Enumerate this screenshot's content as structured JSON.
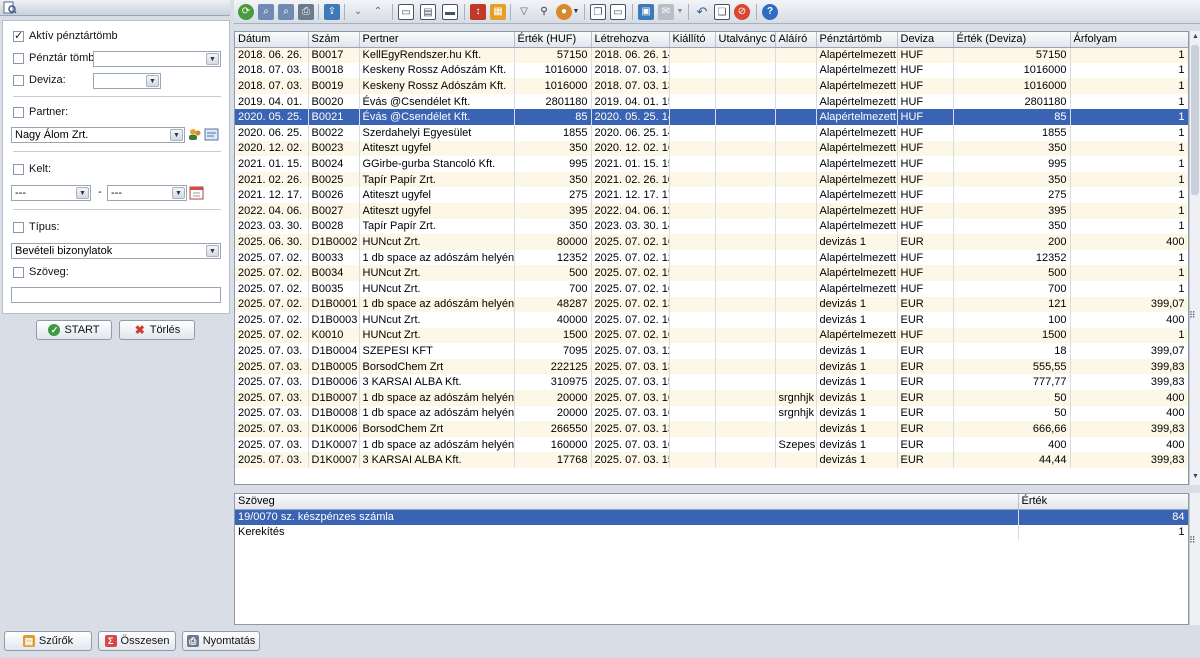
{
  "filters": {
    "active_cashbook": {
      "label": "Aktív pénztártömb",
      "checked": true
    },
    "cashbook": {
      "label": "Pénztár tömb:",
      "checked": false,
      "value": ""
    },
    "currency": {
      "label": "Deviza:",
      "checked": false,
      "value": ""
    },
    "partner": {
      "label": "Partner:",
      "checked": false,
      "value": "Nagy Álom Zrt."
    },
    "date": {
      "label": "Kelt:",
      "checked": false,
      "from": "---",
      "dash": "-",
      "to": "---"
    },
    "type": {
      "label": "Típus:",
      "checked": false,
      "value": "Bevételi bizonylatok"
    },
    "text": {
      "label": "Szöveg:",
      "checked": false,
      "value": ""
    }
  },
  "actions": {
    "start": "START",
    "clear": "Törlés"
  },
  "bottom": {
    "filters": "Szűrők",
    "summary": "Összesen",
    "print": "Nyomtatás"
  },
  "grid": {
    "columns": [
      "Dátum",
      "Szám",
      "Pertner",
      "Érték (HUF)",
      "Létrehozva",
      "Kiállító",
      "Utalványc 0",
      "Aláíró",
      "Pénztártömb",
      "Deviza",
      "Érték (Deviza)",
      "Árfolyam"
    ],
    "selected_index": 4,
    "rows": [
      [
        "2018. 06. 26.",
        "B0017",
        "KellEgyRendszer.hu Kft.",
        "57150",
        "2018. 06. 26. 14:",
        "",
        "",
        "",
        "Alapértelmezett",
        "HUF",
        "57150",
        "1"
      ],
      [
        "2018. 07. 03.",
        "B0018",
        "Keskeny Rossz Adószám Kft.",
        "1016000",
        "2018. 07. 03. 13:",
        "",
        "",
        "",
        "Alapértelmezett",
        "HUF",
        "1016000",
        "1"
      ],
      [
        "2018. 07. 03.",
        "B0019",
        "Keskeny Rossz Adószám Kft.",
        "1016000",
        "2018. 07. 03. 13:",
        "",
        "",
        "",
        "Alapértelmezett",
        "HUF",
        "1016000",
        "1"
      ],
      [
        "2019. 04. 01.",
        "B0020",
        "Évás @Csendélet Kft.",
        "2801180",
        "2019. 04. 01. 15:",
        "",
        "",
        "",
        "Alapértelmezett",
        "HUF",
        "2801180",
        "1"
      ],
      [
        "2020. 05. 25.",
        "B0021",
        "Évás @Csendélet Kft.",
        "85",
        "2020. 05. 25. 14:",
        "",
        "",
        "",
        "Alapértelmezett",
        "HUF",
        "85",
        "1"
      ],
      [
        "2020. 06. 25.",
        "B0022",
        "Szerdahelyi Egyesület",
        "1855",
        "2020. 06. 25. 14:",
        "",
        "",
        "",
        "Alapértelmezett",
        "HUF",
        "1855",
        "1"
      ],
      [
        "2020. 12. 02.",
        "B0023",
        "Atiteszt ugyfel",
        "350",
        "2020. 12. 02. 16:",
        "",
        "",
        "",
        "Alapértelmezett",
        "HUF",
        "350",
        "1"
      ],
      [
        "2021. 01. 15.",
        "B0024",
        "GGirbe-gurba Stancoló Kft.",
        "995",
        "2021. 01. 15. 15:",
        "",
        "",
        "",
        "Alapértelmezett",
        "HUF",
        "995",
        "1"
      ],
      [
        "2021. 02. 26.",
        "B0025",
        "Tapír Papír Zrt.",
        "350",
        "2021. 02. 26. 10:",
        "",
        "",
        "",
        "Alapértelmezett",
        "HUF",
        "350",
        "1"
      ],
      [
        "2021. 12. 17.",
        "B0026",
        "Atiteszt ugyfel",
        "275",
        "2021. 12. 17. 17:",
        "",
        "",
        "",
        "Alapértelmezett",
        "HUF",
        "275",
        "1"
      ],
      [
        "2022. 04. 06.",
        "B0027",
        "Atiteszt ugyfel",
        "395",
        "2022. 04. 06. 11:",
        "",
        "",
        "",
        "Alapértelmezett",
        "HUF",
        "395",
        "1"
      ],
      [
        "2023. 03. 30.",
        "B0028",
        "Tapír Papír Zrt.",
        "350",
        "2023. 03. 30. 14:",
        "",
        "",
        "",
        "Alapértelmezett",
        "HUF",
        "350",
        "1"
      ],
      [
        "2025. 06. 30.",
        "D1B0002",
        "HUNcut Zrt.",
        "80000",
        "2025. 07. 02. 16:",
        "",
        "",
        "",
        "devizás 1",
        "EUR",
        "200",
        "400"
      ],
      [
        "2025. 07. 02.",
        "B0033",
        "1 db space az adószám helyén",
        "12352",
        "2025. 07. 02. 12:",
        "",
        "",
        "",
        "Alapértelmezett",
        "HUF",
        "12352",
        "1"
      ],
      [
        "2025. 07. 02.",
        "B0034",
        "HUNcut Zrt.",
        "500",
        "2025. 07. 02. 15:",
        "",
        "",
        "",
        "Alapértelmezett",
        "HUF",
        "500",
        "1"
      ],
      [
        "2025. 07. 02.",
        "B0035",
        "HUNcut Zrt.",
        "700",
        "2025. 07. 02. 16:",
        "",
        "",
        "",
        "Alapértelmezett",
        "HUF",
        "700",
        "1"
      ],
      [
        "2025. 07. 02.",
        "D1B0001",
        "1 db space az adószám helyén",
        "48287",
        "2025. 07. 02. 13:",
        "",
        "",
        "",
        "devizás 1",
        "EUR",
        "121",
        "399,07"
      ],
      [
        "2025. 07. 02.",
        "D1B0003",
        "HUNcut Zrt.",
        "40000",
        "2025. 07. 02. 16:",
        "",
        "",
        "",
        "devizás 1",
        "EUR",
        "100",
        "400"
      ],
      [
        "2025. 07. 02.",
        "K0010",
        "HUNcut Zrt.",
        "1500",
        "2025. 07. 02. 16:",
        "",
        "",
        "",
        "Alapértelmezett",
        "HUF",
        "1500",
        "1"
      ],
      [
        "2025. 07. 03.",
        "D1B0004",
        "SZEPESI KFT",
        "7095",
        "2025. 07. 03. 11:",
        "",
        "",
        "",
        "devizás 1",
        "EUR",
        "18",
        "399,07"
      ],
      [
        "2025. 07. 03.",
        "D1B0005",
        "BorsodChem Zrt",
        "222125",
        "2025. 07. 03. 13:",
        "",
        "",
        "",
        "devizás 1",
        "EUR",
        "555,55",
        "399,83"
      ],
      [
        "2025. 07. 03.",
        "D1B0006",
        "3 KARSAI ALBA Kft.",
        "310975",
        "2025. 07. 03. 15:",
        "",
        "",
        "",
        "devizás 1",
        "EUR",
        "777,77",
        "399,83"
      ],
      [
        "2025. 07. 03.",
        "D1B0007",
        "1 db space az adószám helyén",
        "20000",
        "2025. 07. 03. 16:",
        "",
        "",
        "srgnhjk",
        "devizás 1",
        "EUR",
        "50",
        "400"
      ],
      [
        "2025. 07. 03.",
        "D1B0008",
        "1 db space az adószám helyén",
        "20000",
        "2025. 07. 03. 16:",
        "",
        "",
        "srgnhjk",
        "devizás 1",
        "EUR",
        "50",
        "400"
      ],
      [
        "2025. 07. 03.",
        "D1K0006",
        "BorsodChem Zrt",
        "266550",
        "2025. 07. 03. 13:",
        "",
        "",
        "",
        "devizás 1",
        "EUR",
        "666,66",
        "399,83"
      ],
      [
        "2025. 07. 03.",
        "D1K0007",
        "1 db space az adószám helyén",
        "160000",
        "2025. 07. 03. 16:",
        "",
        "",
        "Szepesiki",
        "devizás 1",
        "EUR",
        "400",
        "400"
      ],
      [
        "2025. 07. 03.",
        "D1K0007",
        "3 KARSAI ALBA Kft.",
        "17768",
        "2025. 07. 03. 15:",
        "",
        "",
        "",
        "devizás 1",
        "EUR",
        "44,44",
        "399,83"
      ]
    ]
  },
  "detail": {
    "columns": [
      "Szöveg",
      "Érték"
    ],
    "selected_index": 0,
    "rows": [
      [
        "19/0070 sz. készpénzes számla",
        "84"
      ],
      [
        "Kerekítés",
        "1"
      ]
    ]
  }
}
